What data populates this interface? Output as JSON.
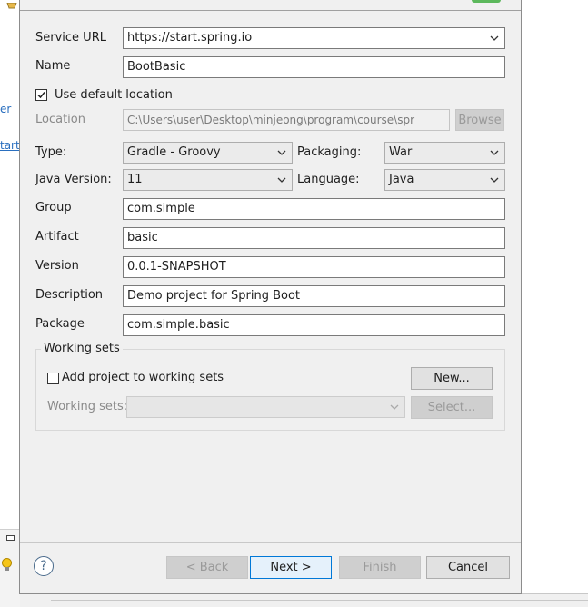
{
  "sidebar": {
    "link1": "er",
    "link2": "tarte"
  },
  "form": {
    "service_url": {
      "label": "Service URL",
      "value": "https://start.spring.io"
    },
    "name": {
      "label": "Name",
      "value": "BootBasic"
    },
    "use_default_location": {
      "label": "Use default location",
      "checked": true
    },
    "location": {
      "label": "Location",
      "value": "C:\\Users\\user\\Desktop\\minjeong\\program\\course\\spr",
      "browse_label": "Browse"
    },
    "type": {
      "label": "Type:",
      "value": "Gradle - Groovy"
    },
    "packaging": {
      "label": "Packaging:",
      "value": "War"
    },
    "java_version": {
      "label": "Java Version:",
      "value": "11"
    },
    "language": {
      "label": "Language:",
      "value": "Java"
    },
    "group": {
      "label": "Group",
      "value": "com.simple"
    },
    "artifact": {
      "label": "Artifact",
      "value": "basic"
    },
    "version": {
      "label": "Version",
      "value": "0.0.1-SNAPSHOT"
    },
    "description": {
      "label": "Description",
      "value": "Demo project for Spring Boot"
    },
    "package": {
      "label": "Package",
      "value": "com.simple.basic"
    }
  },
  "working_sets": {
    "title": "Working sets",
    "add_label": "Add project to working sets",
    "add_checked": false,
    "new_button": "New...",
    "sets_label": "Working sets:",
    "sets_value": "",
    "select_button": "Select..."
  },
  "footer": {
    "help": "?",
    "back": "< Back",
    "next": "Next >",
    "finish": "Finish",
    "cancel": "Cancel"
  }
}
